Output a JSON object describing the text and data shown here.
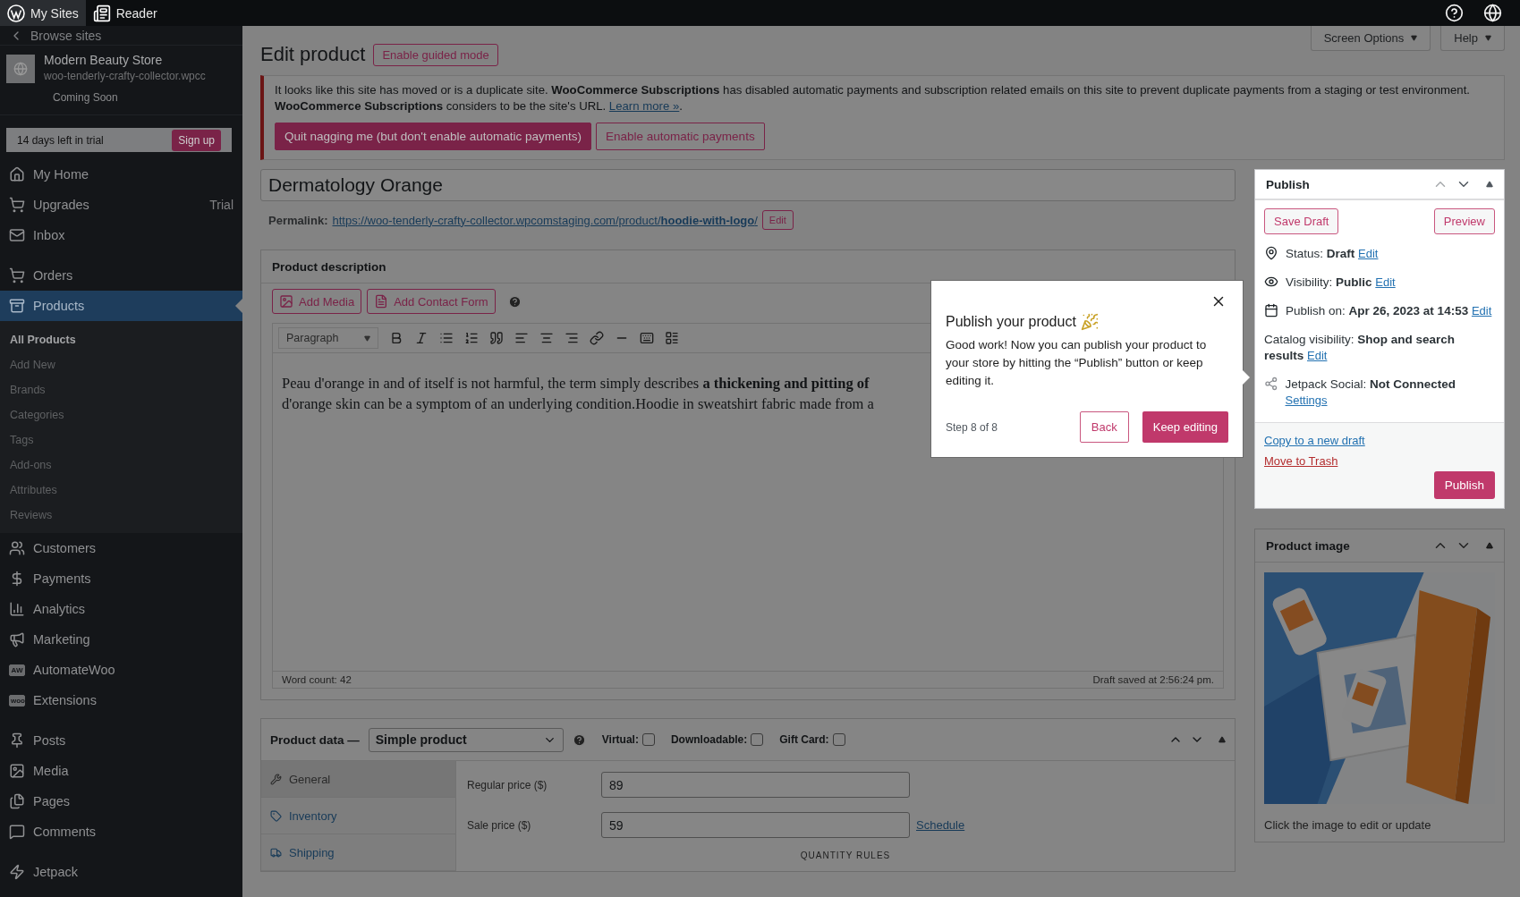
{
  "top_bar": {
    "items": [
      {
        "label": "My Sites",
        "selected": true
      },
      {
        "label": "Reader",
        "selected": false
      }
    ]
  },
  "sidebar": {
    "back": "Browse sites",
    "site": {
      "name": "Modern Beauty Store",
      "url": "woo-tenderly-crafty-collector.wpcc",
      "status": "Coming Soon"
    },
    "trial": {
      "text": "14 days left in trial",
      "button": "Sign up"
    },
    "groups": [
      [
        {
          "label": "My Home",
          "selected": false
        },
        {
          "label": "Upgrades",
          "badge": "Trial",
          "selected": false
        },
        {
          "label": "Inbox",
          "selected": false
        }
      ],
      [
        {
          "label": "Orders",
          "selected": false
        },
        {
          "label": "Products",
          "selected": true,
          "children": [
            {
              "label": "All Products",
              "selected": true
            },
            {
              "label": "Add New",
              "selected": false
            },
            {
              "label": "Brands",
              "selected": false
            },
            {
              "label": "Categories",
              "selected": false
            },
            {
              "label": "Tags",
              "selected": false
            },
            {
              "label": "Add-ons",
              "selected": false
            },
            {
              "label": "Attributes",
              "selected": false
            },
            {
              "label": "Reviews",
              "selected": false
            }
          ]
        },
        {
          "label": "Customers",
          "selected": false
        },
        {
          "label": "Payments",
          "selected": false
        },
        {
          "label": "Analytics",
          "selected": false
        },
        {
          "label": "Marketing",
          "selected": false
        },
        {
          "label": "AutomateWoo",
          "icon_text": "AW",
          "selected": false
        },
        {
          "label": "Extensions",
          "icon_text": "woo",
          "selected": false
        }
      ],
      [
        {
          "label": "Posts",
          "selected": false
        },
        {
          "label": "Media",
          "selected": false
        },
        {
          "label": "Pages",
          "selected": false
        },
        {
          "label": "Comments",
          "selected": false
        }
      ],
      [
        {
          "label": "Jetpack",
          "selected": false
        }
      ]
    ]
  },
  "header": {
    "title": "Edit product",
    "guided": "Enable guided mode",
    "screen_options": "Screen Options",
    "help": "Help"
  },
  "notice": {
    "text": "It looks like this site has moved or is a duplicate site. **WooCommerce Subscriptions** has disabled automatic payments and subscription related emails on this site to prevent duplicate payments from a staging or test environment. **WooCommerce Subscriptions** considers to be the site's URL.",
    "link": "Learn more »",
    "after": ".",
    "buttons": [
      {
        "label": "Quit nagging me (but don't enable automatic payments)",
        "kind": "primary"
      },
      {
        "label": "Enable automatic payments",
        "kind": "secondary"
      }
    ]
  },
  "product_title": "Dermatology Orange",
  "permalink": {
    "label": "Permalink:",
    "url": "https://woo-tenderly-crafty-collector.wpcomstaging.com/product/**hoodie-with-logo**/",
    "edit": "Edit"
  },
  "description": {
    "title": "Product description",
    "media_buttons": [
      "Add Media",
      "Add Contact Form"
    ],
    "format": "Paragraph",
    "lines": [
      "Peau d'orange in and of itself is not harmful, the term simply describes **a thickening and pitting of**",
      "d'orange skin can be a symptom of an underlying condition.Hoodie in sweatshirt fabric made from a"
    ],
    "word_count": "Word count: 42",
    "draft_saved": "Draft saved at 2:56:24 pm."
  },
  "product_data": {
    "title": "Product data —",
    "type": "Simple product",
    "checkboxes": [
      {
        "label": "Virtual:",
        "checked": false
      },
      {
        "label": "Downloadable:",
        "checked": false
      },
      {
        "label": "Gift Card:",
        "checked": false
      }
    ],
    "tabs": [
      {
        "label": "General",
        "selected": true
      },
      {
        "label": "Inventory",
        "selected": false
      },
      {
        "label": "Shipping",
        "selected": false
      }
    ],
    "fields": [
      {
        "label": "Regular price ($)",
        "value": "89"
      },
      {
        "label": "Sale price ($)",
        "value": "59",
        "link": "Schedule"
      }
    ],
    "section": "QUANTITY RULES"
  },
  "publish": {
    "title": "Publish",
    "save_draft": "Save Draft",
    "preview": "Preview",
    "rows": [
      {
        "label": "Status:",
        "value": "Draft",
        "link": "Edit"
      },
      {
        "label": "Visibility:",
        "value": "Public",
        "link": "Edit"
      },
      {
        "label": "Publish on:",
        "value": "Apr 26, 2023 at 14:53",
        "link": "Edit"
      },
      {
        "label": "Catalog visibility:",
        "value": "Shop and search results",
        "link": "Edit"
      },
      {
        "label": "Jetpack Social:",
        "value": "Not Connected",
        "link": "Settings"
      }
    ],
    "copy": "Copy to a new draft",
    "trash": "Move to Trash",
    "button": "Publish"
  },
  "product_image": {
    "title": "Product image",
    "caption": "Click the image to edit or update"
  },
  "tour": {
    "title": "Publish your product",
    "body": "Good work! Now you can publish your product to your store by hitting the “Publish” button or keep editing it.",
    "step": "Step 8 of 8",
    "back": "Back",
    "next": "Keep editing"
  }
}
